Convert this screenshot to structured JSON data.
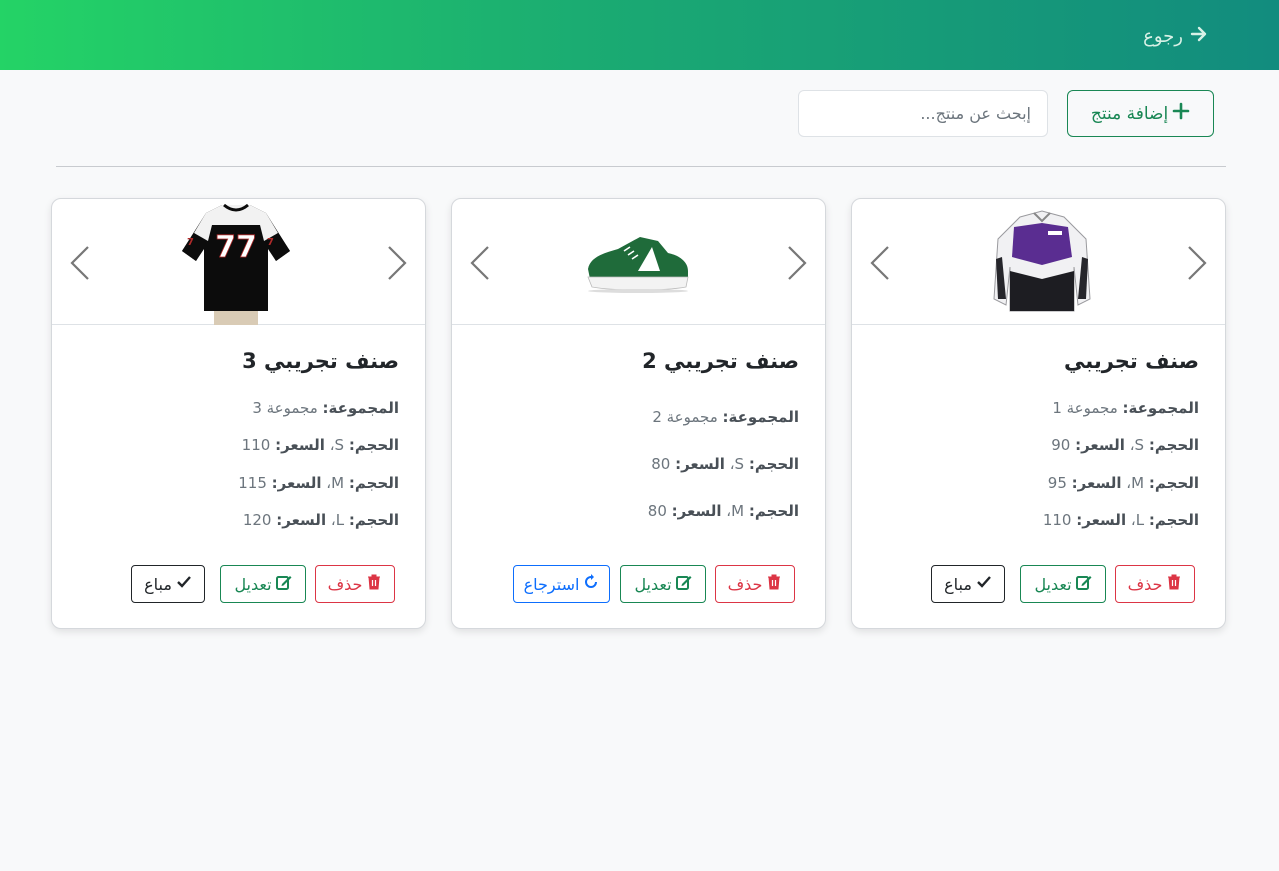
{
  "header": {
    "back_label": "رجوع",
    "gradient": [
      "#24d366",
      "#128c7e"
    ]
  },
  "toolbar": {
    "add_label": "إضافة منتج",
    "search_placeholder": "إبحث عن منتج..."
  },
  "labels": {
    "group": "المجموعة:",
    "size": "الحجم:",
    "price": "السعر:",
    "delete": "حذف",
    "edit": "تعديل",
    "sold": "مباع",
    "restore": "استرجاع"
  },
  "products": [
    {
      "name": "صنف تجريبي",
      "group": "مجموعة 1",
      "image": "jacket",
      "variants": [
        {
          "size": "S",
          "price": "90"
        },
        {
          "size": "M",
          "price": "95"
        },
        {
          "size": "L",
          "price": "110"
        }
      ],
      "status_action": "sold"
    },
    {
      "name": "صنف تجريبي 2",
      "group": "مجموعة 2",
      "image": "sneaker",
      "variants": [
        {
          "size": "S",
          "price": "80"
        },
        {
          "size": "M",
          "price": "80"
        }
      ],
      "status_action": "restore"
    },
    {
      "name": "صنف تجريبي 3",
      "group": "مجموعة 3",
      "image": "jersey",
      "variants": [
        {
          "size": "S",
          "price": "110"
        },
        {
          "size": "M",
          "price": "115"
        },
        {
          "size": "L",
          "price": "120"
        }
      ],
      "status_action": "sold"
    }
  ],
  "colors": {
    "danger": "#dc3545",
    "success": "#198754",
    "primary": "#0d6efd",
    "dark": "#212529"
  }
}
